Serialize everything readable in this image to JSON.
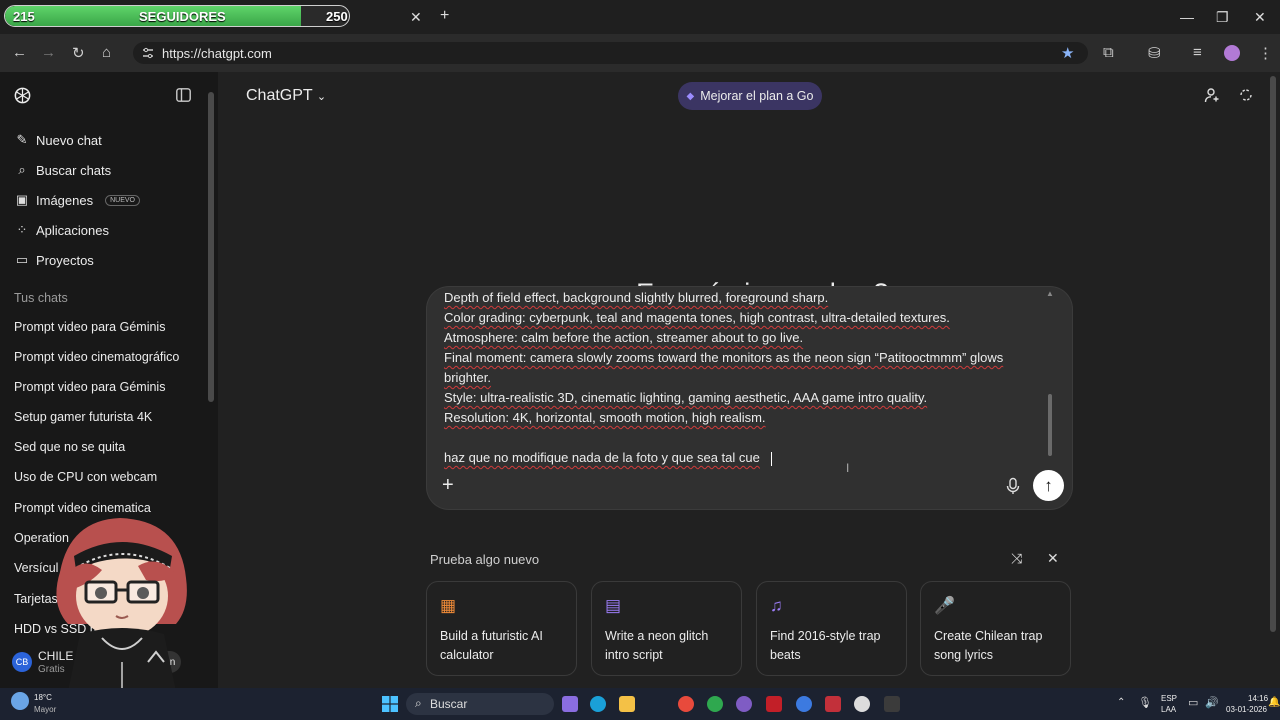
{
  "browser": {
    "followers": {
      "current": "215",
      "label": "SEGUIDORES",
      "goal": "250",
      "progress": 0.86
    },
    "url": "https://chatgpt.com"
  },
  "sidebar": {
    "actions": [
      {
        "label": "Nuevo chat",
        "icon": "new-chat-icon"
      },
      {
        "label": "Buscar chats",
        "icon": "search-icon"
      },
      {
        "label": "Imágenes",
        "icon": "images-icon",
        "badge": "NUEVO"
      },
      {
        "label": "Aplicaciones",
        "icon": "apps-icon"
      },
      {
        "label": "Proyectos",
        "icon": "folder-icon"
      }
    ],
    "section_title": "Tus chats",
    "chats": [
      "Prompt video para Géminis",
      "Prompt video cinematográfico",
      "Prompt video para Géminis",
      "Setup gamer futurista 4K",
      "Sed que no se quita",
      "Uso de CPU con webcam",
      "Prompt video cinematica",
      "Operation",
      "Versícul",
      "Tarjetas K",
      "HDD vs SSD me...arni..."
    ],
    "user": {
      "initials": "CB",
      "name": "CHILE",
      "plan": "Gratis",
      "upgrade": "lan"
    }
  },
  "header": {
    "title": "ChatGPT",
    "upgrade_label": "Mejorar el plan a Go"
  },
  "main": {
    "greeting": "¿En qué piensas hoy?",
    "composer_lines": [
      "Depth of field effect, background slightly blurred, foreground sharp.",
      "Color grading: cyberpunk, teal and magenta tones, high contrast, ultra-detailed textures.",
      "Atmosphere: calm before the action, streamer about to go live.",
      "Final moment: camera slowly zooms toward the monitors as the neon sign “Patitooctmmm” glows",
      "brighter.",
      "Style: ultra-realistic 3D, cinematic lighting, gaming aesthetic, AAA game intro quality.",
      "Resolution: 4K, horizontal, smooth motion, high realism.",
      "",
      "haz que no modifique nada de la foto y que sea tal cue"
    ],
    "try_title": "Prueba algo nuevo",
    "cards": [
      {
        "text": "Build a futuristic AI calculator",
        "icon": "calculator-icon"
      },
      {
        "text": "Write a neon glitch intro script",
        "icon": "clapperboard-icon"
      },
      {
        "text": "Find 2016-style trap beats",
        "icon": "music-icon"
      },
      {
        "text": "Create Chilean trap song lyrics",
        "icon": "microphone-icon"
      }
    ]
  },
  "taskbar": {
    "weather_temp": "18°C",
    "weather_desc": "Mayor",
    "search_placeholder": "Buscar",
    "lang1": "ESP",
    "lang2": "LAA",
    "time": "14:16",
    "date": "03-01-2026"
  },
  "colors": {
    "accent": "#3b3563",
    "followers_fill": "#4cc35a",
    "background": "#212121",
    "sidebar": "#181818"
  }
}
